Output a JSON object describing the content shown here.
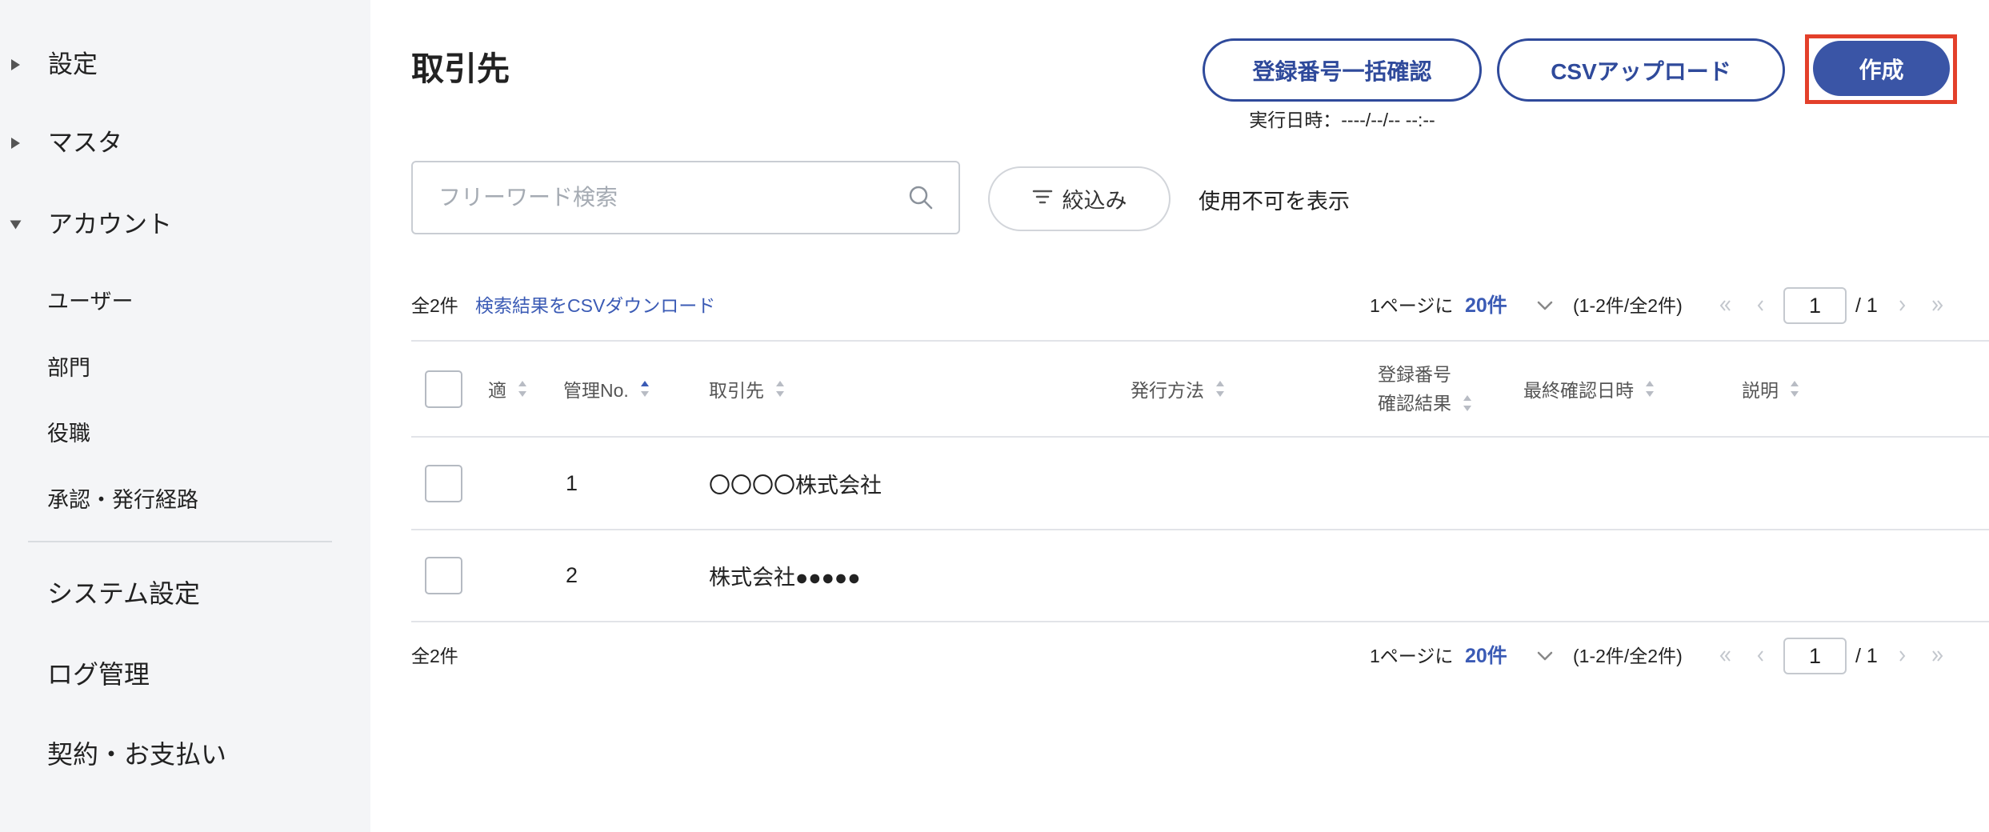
{
  "colors": {
    "accent": "#2f4a9b",
    "accent_fill": "#3a55a6",
    "link": "#3b5bb5",
    "highlight_frame": "#e3402b",
    "sidebar_bg": "#f4f5f7",
    "border": "#e2e4e8",
    "text": "#222222",
    "muted": "#9aa0a8"
  },
  "icons": {
    "section_caret": "caret-icon",
    "search": "search-icon",
    "filter": "filter-icon",
    "per_page_dropdown": "chevron-down-icon",
    "first_page": "first-page-icon",
    "prev_page": "prev-page-icon",
    "next_page": "next-page-icon",
    "last_page": "last-page-icon",
    "sort": "sort-icon"
  },
  "sidebar": {
    "sections": [
      {
        "label": "設定",
        "expanded": false
      },
      {
        "label": "マスタ",
        "expanded": false
      },
      {
        "label": "アカウント",
        "expanded": true
      }
    ],
    "account_items": [
      {
        "label": "ユーザー"
      },
      {
        "label": "部門"
      },
      {
        "label": "役職"
      },
      {
        "label": "承認・発行経路"
      }
    ],
    "bottom_items": [
      {
        "label": "システム設定"
      },
      {
        "label": "ログ管理"
      },
      {
        "label": "契約・お支払い"
      }
    ]
  },
  "header": {
    "title": "取引先",
    "bulk_check_label": "登録番号一括確認",
    "bulk_check_last_run": "実行日時：----/--/-- --:--",
    "csv_upload_label": "CSVアップロード",
    "create_label": "作成"
  },
  "toolbar": {
    "search_placeholder": "フリーワード検索",
    "filter_label": "絞込み",
    "show_disabled_label": "使用不可を表示"
  },
  "summary": {
    "total_label": "全2件",
    "csv_download_label": "検索結果をCSVダウンロード"
  },
  "pagination": {
    "per_page_prefix": "1ページに",
    "per_page_value": "20件",
    "range_label": "(1-2件/全2件)",
    "current_page": "1",
    "total_pages_label": "/ 1"
  },
  "table": {
    "columns": [
      {
        "label": "適",
        "sort_active": false
      },
      {
        "label": "管理No.",
        "sort_active": true
      },
      {
        "label": "取引先",
        "sort_active": false
      },
      {
        "label": "発行方法",
        "sort_active": false
      },
      {
        "label": "登録番号\n確認結果",
        "sort_active": false
      },
      {
        "label": "最終確認日時",
        "sort_active": false
      },
      {
        "label": "説明",
        "sort_active": false
      }
    ],
    "rows": [
      {
        "selected": false,
        "no": "1",
        "partner": "〇〇〇〇株式会社"
      },
      {
        "selected": false,
        "no": "2",
        "partner": "株式会社●●●●●"
      }
    ]
  }
}
